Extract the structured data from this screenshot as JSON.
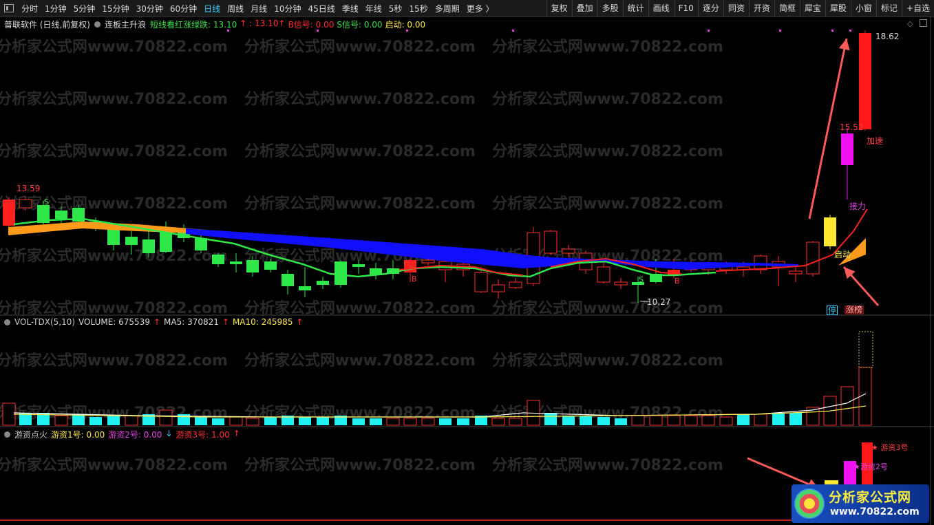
{
  "toolbar": {
    "periods": [
      "分时",
      "1分钟",
      "5分钟",
      "15分钟",
      "30分钟",
      "60分钟",
      "日线",
      "周线",
      "月线",
      "10分钟",
      "45日线",
      "季线",
      "年线",
      "5秒",
      "15秒",
      "多周期",
      "更多 〉"
    ],
    "active_period": "日线",
    "right_tools": [
      "复权",
      "叠加",
      "多股",
      "统计",
      "画线",
      "F10",
      "逐分",
      "同资",
      "开资",
      "简框",
      "犀宝",
      "犀股",
      "小窗",
      "标记",
      "+自选"
    ]
  },
  "main_panel": {
    "title": "普联软件 (日线,前复权)",
    "indicator_name": "连板主升浪",
    "legend": [
      {
        "label": "短线看红涨绿跌: 13.10",
        "color": "#3fe04a"
      },
      {
        "label": "↑",
        "color": "#ff3030"
      },
      {
        "label": ": 13.10↑",
        "color": "#ff3030"
      },
      {
        "label": "B信号: 0.00",
        "color": "#ff3030"
      },
      {
        "label": "S信号: 0.00",
        "color": "#3fe04a"
      },
      {
        "label": "启动: 0.00",
        "color": "#ffe94a"
      }
    ],
    "price_labels": {
      "high_left": "13.59",
      "high_right": "18.62",
      "mid": "15.52",
      "low": "10.27"
    },
    "annotations": {
      "jiasu": "加速",
      "jieli": "接力",
      "qidong": "启动",
      "ting": "停",
      "zhangbang": "涨榜",
      "s": "S",
      "b": "B"
    }
  },
  "vol_panel": {
    "legend": [
      {
        "label": "VOL-TDX(5,10)",
        "color": "#ccc"
      },
      {
        "label": "VOLUME: 675539",
        "color": "#ddd"
      },
      {
        "label": "↑",
        "color": "#ff3030"
      },
      {
        "label": "MA5: 370821",
        "color": "#ddd"
      },
      {
        "label": "↑",
        "color": "#ff3030"
      },
      {
        "label": "MA10: 245985",
        "color": "#ffe94a"
      },
      {
        "label": "↑",
        "color": "#ff3030"
      }
    ]
  },
  "yz_panel": {
    "legend": [
      {
        "label": "游资点火",
        "color": "#ccc"
      },
      {
        "label": "游资1号: 0.00",
        "color": "#ffe94a"
      },
      {
        "label": "游资2号: 0.00",
        "color": "#e040e0"
      },
      {
        "label": "↓",
        "color": "#3fd0ff"
      },
      {
        "label": "游资3号: 1.00",
        "color": "#ff3030"
      },
      {
        "label": "↑",
        "color": "#ff3030"
      }
    ],
    "labels": {
      "y3": "★ 游资3号",
      "y2": "★游资2号"
    }
  },
  "watermark": "分析家公式网www.70822.com",
  "logo": {
    "title": "分析家公式网",
    "url": "www.70822.com"
  }
}
